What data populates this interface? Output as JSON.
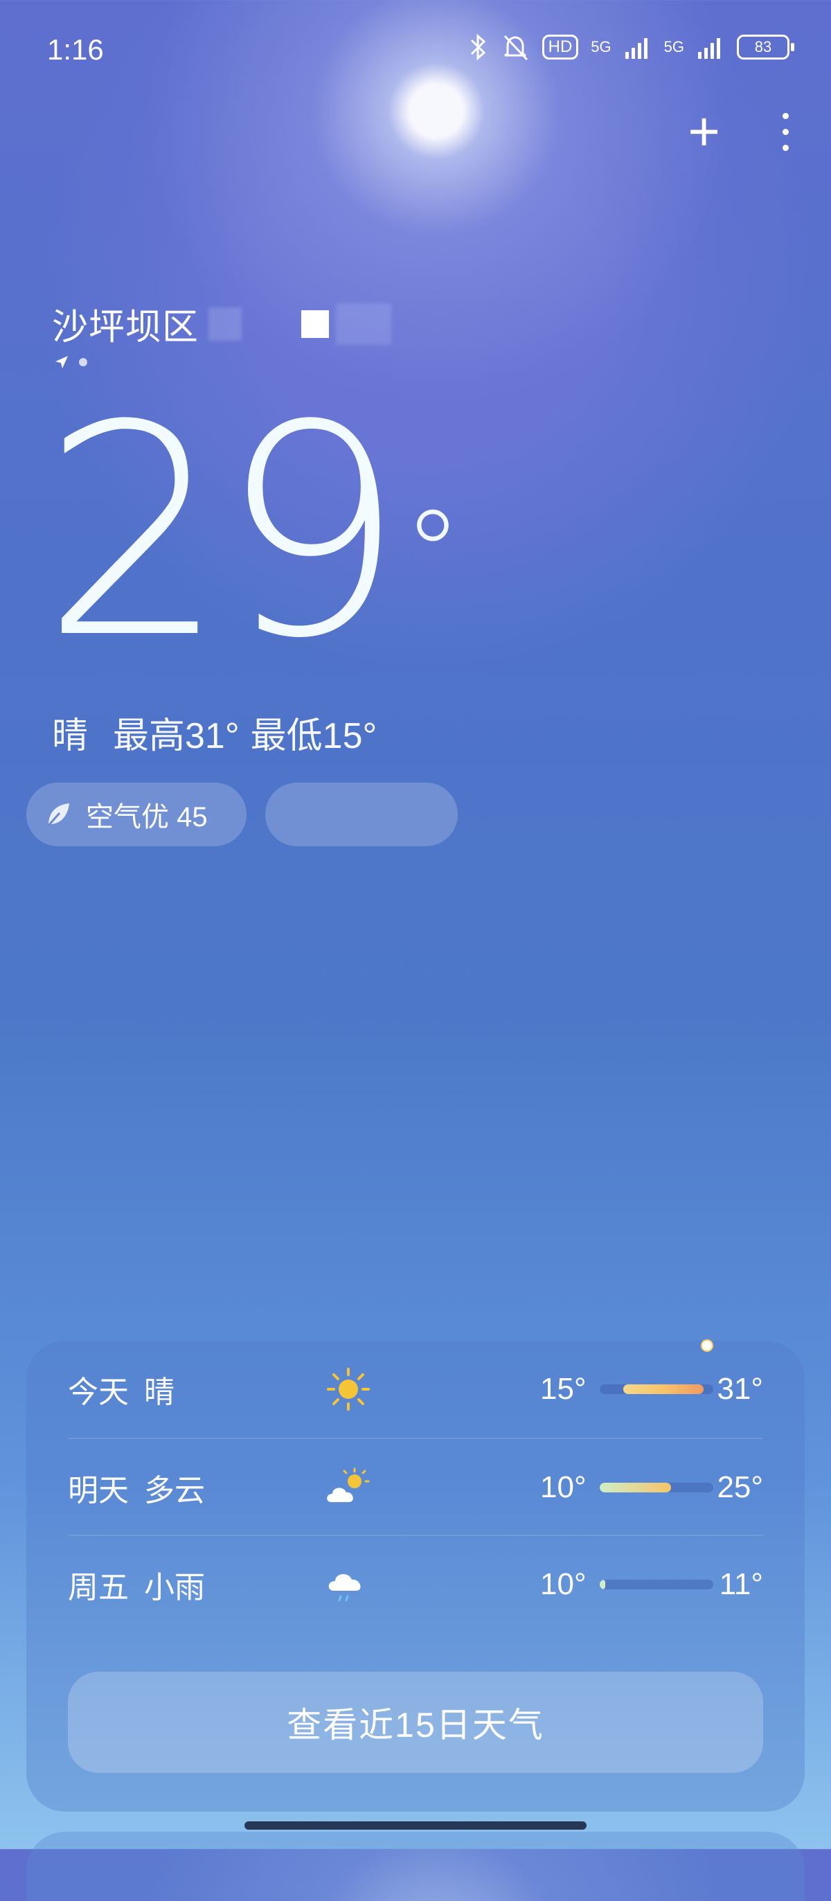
{
  "status_bar": {
    "time": "1:16",
    "hd_label": "HD",
    "net1": "5G",
    "net2": "5G",
    "battery": "83"
  },
  "location": {
    "district": "沙坪坝区"
  },
  "current": {
    "temp": "29",
    "degree": "°",
    "condition": "晴",
    "high": "最高31°",
    "low": "最低15°"
  },
  "chips": {
    "aqi_label": "空气优 45"
  },
  "forecast": [
    {
      "day": "今天",
      "condition": "晴",
      "icon": "sun-icon",
      "low": "15°",
      "high": "31°"
    },
    {
      "day": "明天",
      "condition": "多云",
      "icon": "partly-cloudy-icon",
      "low": "10°",
      "high": "25°"
    },
    {
      "day": "周五",
      "condition": "小雨",
      "icon": "light-rain-icon",
      "low": "10°",
      "high": "11°"
    }
  ],
  "forecast_button": "查看近15日天气",
  "colors": {
    "accent_warm": "#f6c46a",
    "accent_cool": "#cfeec6",
    "bar_track": "#3c5aaa"
  }
}
